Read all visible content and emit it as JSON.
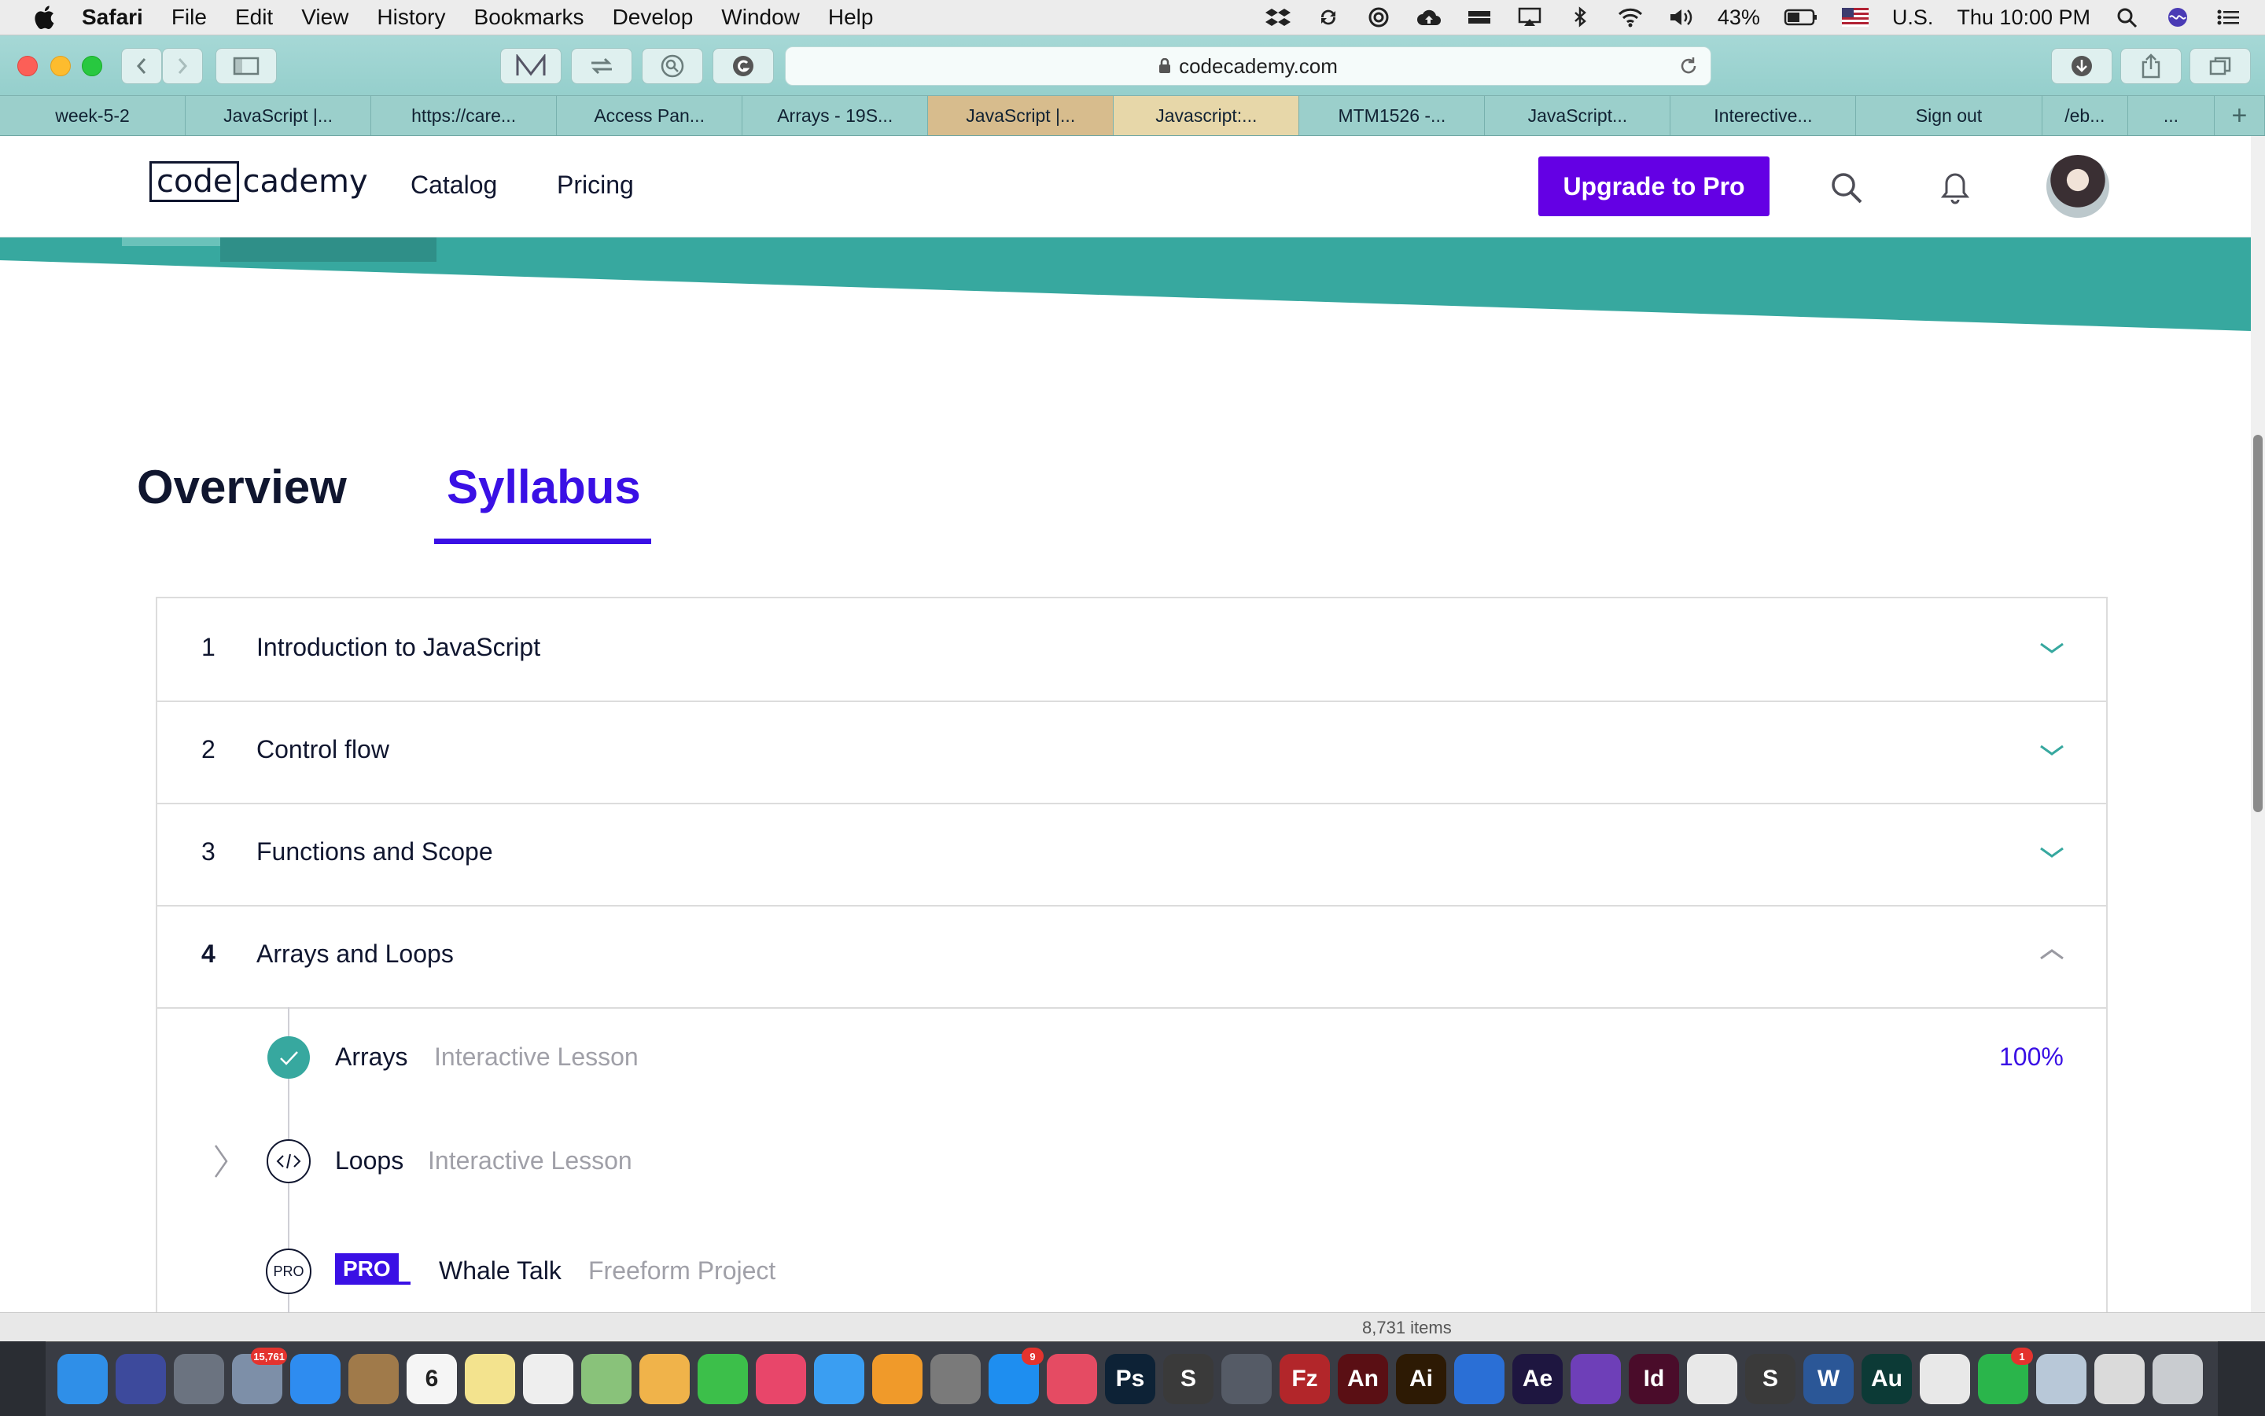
{
  "menubar": {
    "app": "Safari",
    "items": [
      "File",
      "Edit",
      "View",
      "History",
      "Bookmarks",
      "Develop",
      "Window",
      "Help"
    ],
    "battery": "43%",
    "input_source": "U.S.",
    "clock": "Thu 10:00 PM"
  },
  "toolbar": {
    "url": "codecademy.com"
  },
  "tabs": [
    {
      "label": "week-5-2",
      "style": "normal"
    },
    {
      "label": "JavaScript |...",
      "style": "normal"
    },
    {
      "label": "https://care...",
      "style": "normal"
    },
    {
      "label": "Access Pan...",
      "style": "normal"
    },
    {
      "label": "Arrays - 19S...",
      "style": "normal"
    },
    {
      "label": "JavaScript |...",
      "style": "orange"
    },
    {
      "label": "Javascript:...",
      "style": "active"
    },
    {
      "label": "MTM1526 -...",
      "style": "normal"
    },
    {
      "label": "JavaScript...",
      "style": "normal"
    },
    {
      "label": "Interective...",
      "style": "normal"
    },
    {
      "label": "Sign out",
      "style": "normal"
    },
    {
      "label": "/eb...",
      "style": "narrow"
    },
    {
      "label": "...",
      "style": "narrow"
    }
  ],
  "header": {
    "logo_box": "code",
    "logo_rest": "cademy",
    "nav": [
      "Catalog",
      "Pricing"
    ],
    "upgrade_label": "Upgrade to Pro"
  },
  "page_tabs": {
    "overview": "Overview",
    "syllabus": "Syllabus"
  },
  "colors": {
    "accent": "#3a10e5",
    "upgrade": "#6400e4",
    "teal": "#37a89f"
  },
  "syllabus": {
    "modules": [
      {
        "num": "1",
        "title": "Introduction to JavaScript",
        "expanded": false
      },
      {
        "num": "2",
        "title": "Control flow",
        "expanded": false
      },
      {
        "num": "3",
        "title": "Functions and Scope",
        "expanded": false
      },
      {
        "num": "4",
        "title": "Arrays and Loops",
        "expanded": true
      }
    ],
    "lessons": [
      {
        "title": "Arrays",
        "type": "Interactive Lesson",
        "progress": "100%",
        "status": "complete"
      },
      {
        "title": "Loops",
        "type": "Interactive Lesson",
        "status": "current"
      },
      {
        "title": "Whale Talk",
        "type": "Freeform Project",
        "status": "pro",
        "badge": "PRO",
        "icon_label": "PRO"
      }
    ]
  },
  "finder": {
    "items_count": "8,731 items"
  },
  "dock": {
    "icons": [
      {
        "name": "finder-icon",
        "color": "#2f8fe8",
        "text": ""
      },
      {
        "name": "siri-icon",
        "color": "#3d4a9c",
        "text": ""
      },
      {
        "name": "launchpad-icon",
        "color": "#6b7380",
        "text": ""
      },
      {
        "name": "mail-stamp-icon",
        "color": "#7d8fa8",
        "text": "",
        "badge": "15,761"
      },
      {
        "name": "safari-icon",
        "color": "#2e8cf0",
        "text": ""
      },
      {
        "name": "notefile-icon",
        "color": "#a07a4a",
        "text": ""
      },
      {
        "name": "calendar-icon",
        "color": "#f5f5f5",
        "text": "6"
      },
      {
        "name": "notes-icon",
        "color": "#f3e38e",
        "text": ""
      },
      {
        "name": "reminders-icon",
        "color": "#eeeeee",
        "text": ""
      },
      {
        "name": "maps-icon",
        "color": "#89c27a",
        "text": ""
      },
      {
        "name": "photos-icon",
        "color": "#f0b34a",
        "text": ""
      },
      {
        "name": "facetime-icon",
        "color": "#3cbf4a",
        "text": ""
      },
      {
        "name": "itunes-icon",
        "color": "#e8466a",
        "text": ""
      },
      {
        "name": "messages-icon",
        "color": "#3a9ef2",
        "text": ""
      },
      {
        "name": "ibooks-icon",
        "color": "#f09a2a",
        "text": ""
      },
      {
        "name": "system-preferences-icon",
        "color": "#7a7a7a",
        "text": ""
      },
      {
        "name": "app-store-icon",
        "color": "#1e8ef0",
        "text": "",
        "badge": "9"
      },
      {
        "name": "petal-icon",
        "color": "#e54b63",
        "text": ""
      },
      {
        "name": "photoshop-icon",
        "color": "#0d2236",
        "text": "Ps"
      },
      {
        "name": "sublime-icon",
        "color": "#3a3a3a",
        "text": "S"
      },
      {
        "name": "tableplus-icon",
        "color": "#555b66",
        "text": ""
      },
      {
        "name": "filezilla-icon",
        "color": "#b2262a",
        "text": "Fz"
      },
      {
        "name": "animate-icon",
        "color": "#5a0f14",
        "text": "An"
      },
      {
        "name": "illustrator-icon",
        "color": "#2d1a04",
        "text": "Ai"
      },
      {
        "name": "frame-icon",
        "color": "#2a6fd6",
        "text": ""
      },
      {
        "name": "after-effects-icon",
        "color": "#1e1640",
        "text": "Ae"
      },
      {
        "name": "github-icon",
        "color": "#6e3fb8",
        "text": ""
      },
      {
        "name": "indesign-icon",
        "color": "#4a0c2a",
        "text": "Id"
      },
      {
        "name": "chrome-icon",
        "color": "#e8e8e8",
        "text": ""
      },
      {
        "name": "sublime-text-icon",
        "color": "#3a3a3a",
        "text": "S"
      },
      {
        "name": "word-icon",
        "color": "#2b5797",
        "text": "W"
      },
      {
        "name": "audition-icon",
        "color": "#0c3a36",
        "text": "Au"
      },
      {
        "name": "chrome-canary-icon",
        "color": "#e8e8e8",
        "text": ""
      },
      {
        "name": "whatsapp-icon",
        "color": "#2ab54b",
        "text": "",
        "badge": "1"
      },
      {
        "name": "preview-icon",
        "color": "#b8c8d8",
        "text": ""
      },
      {
        "name": "documents-icon",
        "color": "#dadada",
        "text": ""
      },
      {
        "name": "trash-icon",
        "color": "#c9ccd0",
        "text": ""
      }
    ]
  }
}
